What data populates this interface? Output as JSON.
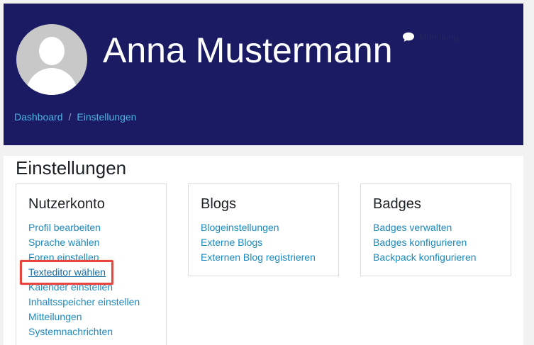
{
  "header": {
    "user_name": "Anna Mustermann",
    "message_label": "Mitteilung",
    "breadcrumb": [
      "Dashboard",
      "Einstellungen"
    ],
    "breadcrumb_separator": "/",
    "background_color": "#1a1b63"
  },
  "main": {
    "title": "Einstellungen",
    "cards": [
      {
        "title": "Nutzerkonto",
        "links": [
          "Profil bearbeiten",
          "Sprache wählen",
          "Foren einstellen",
          "Texteditor wählen",
          "Kalender einstellen",
          "Inhaltsspeicher einstellen",
          "Mitteilungen",
          "Systemnachrichten"
        ],
        "highlighted_link": "Texteditor wählen"
      },
      {
        "title": "Blogs",
        "links": [
          "Blogeinstellungen",
          "Externe Blogs",
          "Externen Blog registrieren"
        ]
      },
      {
        "title": "Badges",
        "links": [
          "Badges verwalten",
          "Badges konfigurieren",
          "Backpack konfigurieren"
        ]
      }
    ]
  },
  "colors": {
    "link": "#1a8ac0",
    "breadcrumb_link": "#4db4e6",
    "highlight_border": "#e8453c"
  },
  "icons": {
    "avatar": "default-user-avatar",
    "message": "speech-bubble-icon"
  }
}
